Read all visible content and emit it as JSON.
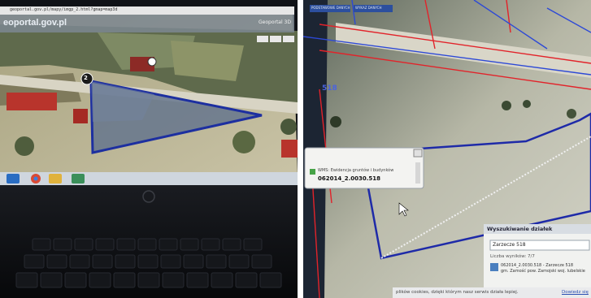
{
  "left_photo": {
    "browser_url": "geoportal.gov.pl/mapy/imgp_2.html?gmap=map3d",
    "site_logo": "eoportal.gov.pl",
    "header_right": "Geoportal 3D",
    "toolbar_buttons": [
      "",
      "",
      ""
    ],
    "parcel_marker_label": "2",
    "taskbar_icons": [
      "browser-icon",
      "chrome-icon",
      "folder-icon",
      "media-icon"
    ],
    "laptop_brand": "hp"
  },
  "right_photo": {
    "top_tabs": [
      "PODSTAWOWE DANYCH",
      "WYKAZ DANYCH"
    ],
    "parcel_label": "518",
    "tooltip": {
      "title": "WMS: Ewidencja gruntów i budynków",
      "value": "062014_2.0030.518"
    },
    "search_panel": {
      "title": "Wyszukiwanie działek",
      "input_value": "Zarzecze 518",
      "results_count": "Liczba wyników: 7/7",
      "result_line1": "062014_2.0030.518 - Zarzecze 518",
      "result_line2": "gm. Zamość pow. Zamojski woj. lubelskie"
    },
    "footer_text": "plików cookies, dzięki którym nasz serwis działa lepiej.",
    "footer_link": "Dowiedz się"
  }
}
